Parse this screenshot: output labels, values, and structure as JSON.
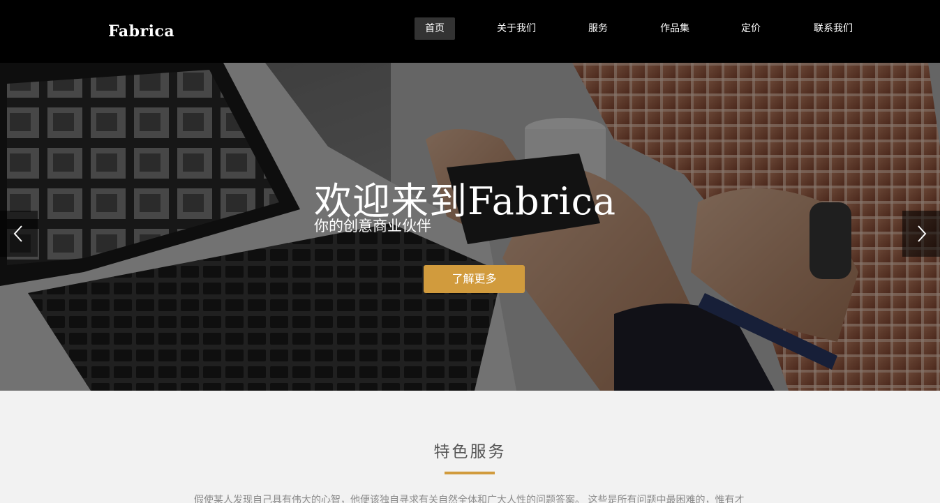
{
  "header": {
    "logo": "Fabrica",
    "nav": [
      {
        "label": "首页",
        "active": true
      },
      {
        "label": "关于我们"
      },
      {
        "label": "服务"
      },
      {
        "label": "作品集"
      },
      {
        "label": "定价"
      },
      {
        "label": "联系我们"
      }
    ]
  },
  "hero": {
    "title": "欢迎来到Fabrica",
    "subtitle": "你的创意商业伙伴",
    "button_label": "了解更多",
    "prev_icon": "chevron-left-icon",
    "next_icon": "chevron-right-icon",
    "accent_color": "#d19b3d"
  },
  "services": {
    "title": "特色服务",
    "text": "假使某人发现自己具有伟大的心智，他便该独自寻求有关自然全体和广大人性的问题答案。 这些是所有问题中最困难的，惟有才"
  }
}
